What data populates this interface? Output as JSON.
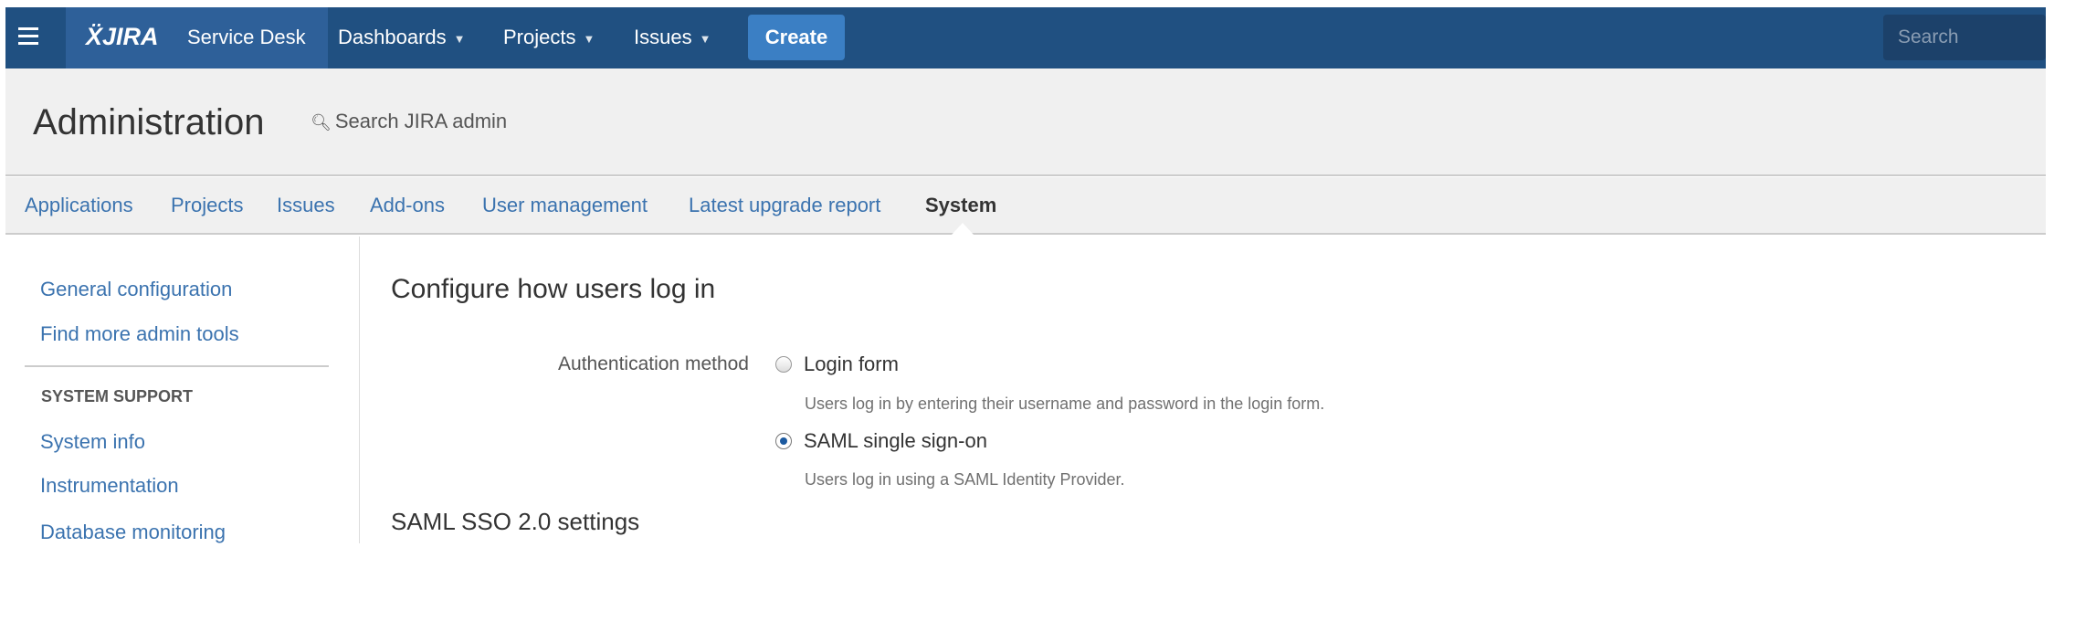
{
  "nav": {
    "logo": "JIRA",
    "product": "Service Desk",
    "menus": [
      {
        "label": "Dashboards"
      },
      {
        "label": "Projects"
      },
      {
        "label": "Issues"
      }
    ],
    "create_label": "Create",
    "search_placeholder": "Search"
  },
  "admin": {
    "title": "Administration",
    "search_label": "Search JIRA admin"
  },
  "tabs": [
    {
      "label": "Applications"
    },
    {
      "label": "Projects"
    },
    {
      "label": "Issues"
    },
    {
      "label": "Add-ons"
    },
    {
      "label": "User management"
    },
    {
      "label": "Latest upgrade report"
    },
    {
      "label": "System",
      "active": true
    }
  ],
  "sidebar": {
    "items": [
      {
        "label": "General configuration"
      },
      {
        "label": "Find more admin tools"
      }
    ],
    "section_title": "SYSTEM SUPPORT",
    "section_items": [
      {
        "label": "System info"
      },
      {
        "label": "Instrumentation"
      },
      {
        "label": "Database monitoring"
      }
    ]
  },
  "main": {
    "title": "Configure how users log in",
    "field_label": "Authentication method",
    "options": [
      {
        "label": "Login form",
        "description": "Users log in by entering their username and password in the login form.",
        "selected": false
      },
      {
        "label": "SAML single sign-on",
        "description": "Users log in using a SAML Identity Provider.",
        "selected": true
      }
    ],
    "section_title": "SAML SSO 2.0 settings"
  },
  "colors": {
    "nav": "#205081",
    "link": "#3b73af",
    "create": "#3b7fc4"
  }
}
